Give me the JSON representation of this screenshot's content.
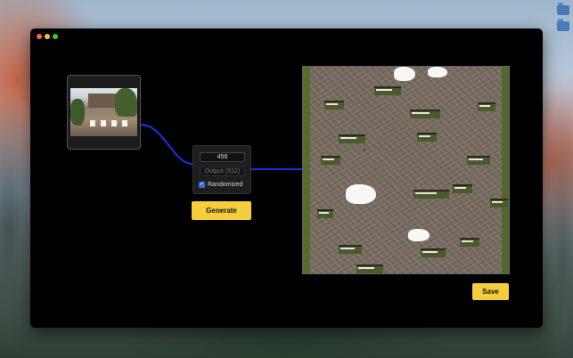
{
  "window": {
    "controls": [
      "close",
      "minimize",
      "zoom"
    ]
  },
  "input_node": {
    "image": "building-photo"
  },
  "generator": {
    "seed_value": "456",
    "output_placeholder": "Output (512)",
    "randomized_label": "Randomized",
    "randomized_checked": true,
    "generate_label": "Generate"
  },
  "output_panel": {
    "image": "generated-texture"
  },
  "save_label": "Save",
  "colors": {
    "accent_button": "#f4ce3c",
    "wire": "#1a2fd6",
    "checkbox": "#2f73d8",
    "window_bg": "#000000"
  }
}
